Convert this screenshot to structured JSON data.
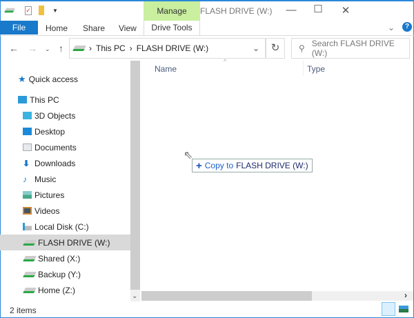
{
  "window": {
    "title": "FLASH DRIVE (W:)",
    "context_tab": "Manage"
  },
  "ribbon": {
    "tabs": [
      "File",
      "Home",
      "Share",
      "View",
      "Drive Tools"
    ]
  },
  "address": {
    "segments": [
      "This PC",
      "FLASH DRIVE (W:)"
    ],
    "search_placeholder": "Search FLASH DRIVE (W:)"
  },
  "sidebar": {
    "items": [
      {
        "label": "Quick access",
        "icon": "star-icon"
      },
      {
        "label": "This PC",
        "icon": "computer-icon"
      },
      {
        "label": "3D Objects",
        "icon": "cube-icon"
      },
      {
        "label": "Desktop",
        "icon": "desktop-icon"
      },
      {
        "label": "Documents",
        "icon": "document-icon"
      },
      {
        "label": "Downloads",
        "icon": "download-icon"
      },
      {
        "label": "Music",
        "icon": "music-icon"
      },
      {
        "label": "Pictures",
        "icon": "picture-icon"
      },
      {
        "label": "Videos",
        "icon": "video-icon"
      },
      {
        "label": "Local Disk (C:)",
        "icon": "disk-icon"
      },
      {
        "label": "FLASH DRIVE (W:)",
        "icon": "drive-icon"
      },
      {
        "label": "Shared (X:)",
        "icon": "drive-icon"
      },
      {
        "label": "Backup (Y:)",
        "icon": "drive-icon"
      },
      {
        "label": "Home (Z:)",
        "icon": "drive-icon"
      }
    ]
  },
  "columns": [
    "Name",
    "Type"
  ],
  "drag_tip": {
    "action": "Copy to",
    "target": "FLASH DRIVE (W:)"
  },
  "status": {
    "count": "2 items"
  },
  "colors": {
    "accent": "#1979ca",
    "manage": "#c9ef9f"
  }
}
